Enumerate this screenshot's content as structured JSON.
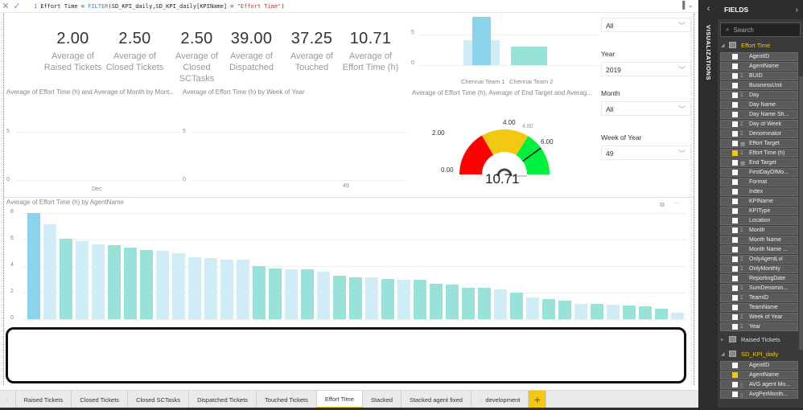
{
  "formula_bar": {
    "cancel_icon": "close-icon",
    "commit_icon": "check-icon",
    "line_number": "1",
    "measure_name": "Effort Time = ",
    "function_name": "FILTER",
    "args": "(SD_KPI_daily,SD_KPI_daily[KPIName] = ",
    "string_literal": "\"Effort Time\"",
    "close_paren": ")"
  },
  "cards": [
    {
      "value": "2.00",
      "label_line1": "Average of",
      "label_line2": "Raised Tickets"
    },
    {
      "value": "2.50",
      "label_line1": "Average of",
      "label_line2": "Closed Tickets"
    },
    {
      "value": "2.50",
      "label_line1": "Average of",
      "label_line2": "Closed SCTasks"
    },
    {
      "value": "39.00",
      "label_line1": "Average of",
      "label_line2": "Dispatched"
    },
    {
      "value": "37.25",
      "label_line1": "Average of",
      "label_line2": "Touched"
    },
    {
      "value": "10.71",
      "label_line1": "Average of",
      "label_line2": "Effort Time (h)"
    }
  ],
  "month_chart": {
    "title": "Average of Effort Time (h) and Average of Month by Mont...",
    "y_ticks": [
      "5",
      "0"
    ],
    "x_label": "Dec"
  },
  "week_chart": {
    "title": "Average of Effort Time (h) by Week of Year",
    "y_ticks": [
      "5",
      "0"
    ],
    "x_label": "49"
  },
  "team_chart": {
    "title": "Average of Effort Time (h), Average of End Target and Averag...",
    "y_ticks": [
      "5",
      "0"
    ],
    "categories": [
      "Chennai Team 1",
      "Chennai Team 2"
    ],
    "series": [
      {
        "name": "Average of Effort Time (h)",
        "values": [
          7.9,
          3.0
        ]
      },
      {
        "name": "Average of End Target",
        "values": [
          4.1,
          3.0
        ]
      }
    ],
    "ylim": [
      0,
      8
    ]
  },
  "gauge": {
    "value": "10.71",
    "labels": [
      "0.00",
      "2.00",
      "4.00",
      "4.80",
      "6.00"
    ],
    "min": 0,
    "max": 6,
    "target": 4.8,
    "bands": [
      {
        "from": 0,
        "to": 2,
        "color": "#ff0000"
      },
      {
        "from": 2,
        "to": 4.05,
        "color": "#f2c811"
      },
      {
        "from": 4.05,
        "to": 6,
        "color": "#00f040"
      }
    ]
  },
  "slicers": [
    {
      "label": "",
      "value": "All"
    },
    {
      "label": "Year",
      "value": "2019"
    },
    {
      "label": "Month",
      "value": "All"
    },
    {
      "label": "Week of Year",
      "value": "49"
    }
  ],
  "agent_chart": {
    "title": "Average of Effort Time (h) by AgentName",
    "y_ticks": [
      "8",
      "6",
      "4",
      "2",
      "0"
    ],
    "ylim": [
      0,
      8
    ],
    "focus_icon": "focus-mode-icon",
    "more_icon": "more-options-icon"
  },
  "chart_data": {
    "type": "bar",
    "title": "Average of Effort Time (h) by AgentName",
    "xlabel": "",
    "ylabel": "",
    "ylim": [
      0,
      8
    ],
    "yticks": [
      0,
      2,
      4,
      6,
      8
    ],
    "grid": true,
    "colors": {
      "highlight": "#89d3eb",
      "team1": "#d0ecf6",
      "team2": "#98e2da"
    },
    "values": [
      8.0,
      7.15,
      6.05,
      5.9,
      5.65,
      5.55,
      5.4,
      5.2,
      5.15,
      4.95,
      4.65,
      4.6,
      4.5,
      4.5,
      4.0,
      3.8,
      3.75,
      3.75,
      3.55,
      3.25,
      3.17,
      3.15,
      3.05,
      3.0,
      2.95,
      2.65,
      2.63,
      2.38,
      2.35,
      2.25,
      1.98,
      1.64,
      1.5,
      1.42,
      1.15,
      1.13,
      1.07,
      1.03,
      0.97,
      0.77,
      0.5
    ],
    "bar_group": [
      "highlight",
      "team1",
      "team2",
      "team1",
      "team1",
      "team2",
      "team2",
      "team2",
      "team1",
      "team1",
      "team1",
      "team1",
      "team1",
      "team1",
      "team2",
      "team2",
      "team1",
      "team2",
      "team1",
      "team2",
      "team2",
      "team1",
      "team2",
      "team1",
      "team2",
      "team2",
      "team2",
      "team2",
      "team2",
      "team1",
      "team2",
      "team1",
      "team2",
      "team2",
      "team1",
      "team2",
      "team1",
      "team2",
      "team2",
      "team2",
      "team1"
    ]
  },
  "tabs": [
    {
      "label": "Raised Tickets",
      "active": false
    },
    {
      "label": "Closed Tickets",
      "active": false
    },
    {
      "label": "Closed SCTasks",
      "active": false
    },
    {
      "label": "Dispatched Tickets",
      "active": false
    },
    {
      "label": "Touched Tickets",
      "active": false
    },
    {
      "label": "Effort Time",
      "active": true
    },
    {
      "label": "Stacked",
      "active": false
    },
    {
      "label": "Stacked agent fixed",
      "active": false
    },
    {
      "label": "development",
      "active": false,
      "icon": "hidden-page-icon"
    }
  ],
  "add_tab_label": "+",
  "visualizations_pane": {
    "label": "VISUALIZATIONS",
    "collapse_icon": "chevron-left-icon"
  },
  "fields_pane": {
    "title": "FIELDS",
    "expand_icon": "chevron-right-icon",
    "search_placeholder": "Search",
    "tables": [
      {
        "name": "Effort Time",
        "expanded": true,
        "highlighted": true,
        "fields": [
          {
            "name": "AgentID",
            "type": "",
            "checked": false
          },
          {
            "name": "AgentName",
            "type": "",
            "checked": false
          },
          {
            "name": "BUID",
            "type": "sigma",
            "checked": false
          },
          {
            "name": "BusinessUnit",
            "type": "",
            "checked": false
          },
          {
            "name": "Day",
            "type": "sigma",
            "checked": false
          },
          {
            "name": "Day Name",
            "type": "",
            "checked": false
          },
          {
            "name": "Day Name Sh...",
            "type": "",
            "checked": false
          },
          {
            "name": "Day of Week",
            "type": "sigma",
            "checked": false
          },
          {
            "name": "Denominator",
            "type": "sigma",
            "checked": false
          },
          {
            "name": "Effort Target",
            "type": "kpi",
            "checked": false
          },
          {
            "name": "Effort Time (h)",
            "type": "sigma",
            "checked": true
          },
          {
            "name": "End Target",
            "type": "kpi",
            "checked": false
          },
          {
            "name": "FirstDayOfMo...",
            "type": "",
            "checked": false
          },
          {
            "name": "Format",
            "type": "",
            "checked": false
          },
          {
            "name": "Index",
            "type": "",
            "checked": false
          },
          {
            "name": "KPIName",
            "type": "",
            "checked": false
          },
          {
            "name": "KPIType",
            "type": "",
            "checked": false
          },
          {
            "name": "Location",
            "type": "",
            "checked": false
          },
          {
            "name": "Month",
            "type": "sigma",
            "checked": false
          },
          {
            "name": "Month Name",
            "type": "",
            "checked": false
          },
          {
            "name": "Month Name ...",
            "type": "",
            "checked": false
          },
          {
            "name": "OnlyAgentLvl",
            "type": "sigma",
            "checked": false
          },
          {
            "name": "OnlyMonthly",
            "type": "sigma",
            "checked": false
          },
          {
            "name": "ReportingDate",
            "type": "",
            "checked": false
          },
          {
            "name": "SumDenomin...",
            "type": "sigma",
            "checked": false
          },
          {
            "name": "TeamID",
            "type": "sigma",
            "checked": false
          },
          {
            "name": "TeamName",
            "type": "",
            "checked": false
          },
          {
            "name": "Week of Year",
            "type": "sigma",
            "checked": false
          },
          {
            "name": "Year",
            "type": "sigma",
            "checked": false
          }
        ]
      },
      {
        "name": "Raised Tickets",
        "expanded": false,
        "highlighted": false,
        "fields": []
      },
      {
        "name": "SD_KPI_daily",
        "expanded": true,
        "highlighted": true,
        "fields": [
          {
            "name": "AgentID",
            "type": "",
            "checked": false
          },
          {
            "name": "AgentName",
            "type": "",
            "checked": true
          },
          {
            "name": "AVG agent Mo...",
            "type": "calc",
            "checked": false
          },
          {
            "name": "AvgPerMonth...",
            "type": "calc",
            "checked": false
          }
        ]
      }
    ]
  }
}
